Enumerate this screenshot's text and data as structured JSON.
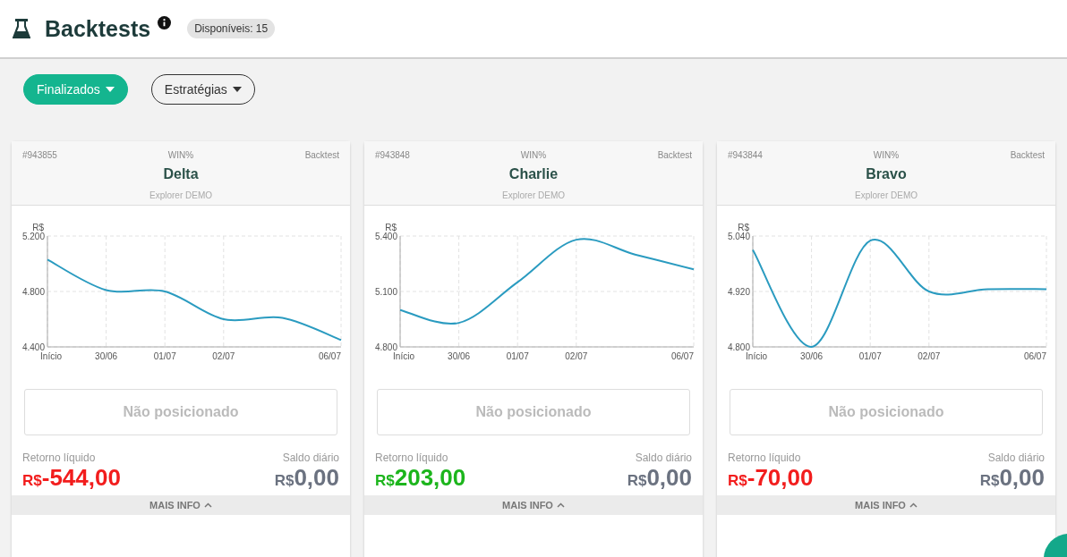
{
  "header": {
    "title": "Backtests",
    "badge": "Disponíveis: 15"
  },
  "filters": [
    {
      "label": "Finalizados",
      "selected": true
    },
    {
      "label": "Estratégias",
      "selected": false
    }
  ],
  "cards": [
    {
      "id": "#943855",
      "symbol": "WIN%",
      "type": "Backtest",
      "name": "Delta",
      "account": "Explorer DEMO",
      "chart_data": {
        "type": "line",
        "grid": true,
        "ylabel": "R$",
        "categories": [
          "Início",
          "30/06",
          "01/07",
          "02/07",
          null,
          "06/07"
        ],
        "series": [
          {
            "color": "#2a9bc0",
            "values": [
              5030,
              4810,
              4800,
              4600,
              4610,
              4450
            ]
          }
        ],
        "ylim": [
          4400,
          5200
        ],
        "yticks": [
          {
            "value": 4400,
            "label": "4.400"
          },
          {
            "value": 4800,
            "label": "4.800"
          },
          {
            "value": 5200,
            "label": "5.200"
          }
        ]
      },
      "status": "Não posicionado",
      "return_label": "Retorno líquido",
      "return_currency": "R$",
      "return_value": "-544,00",
      "color": "#f21d1d",
      "balance_label": "Saldo diário",
      "balance_currency": "R$",
      "balance_value": "0,00",
      "more": "MAIS INFO"
    },
    {
      "id": "#943848",
      "symbol": "WIN%",
      "type": "Backtest",
      "name": "Charlie",
      "account": "Explorer DEMO",
      "chart_data": {
        "type": "line",
        "grid": true,
        "ylabel": "R$",
        "categories": [
          "Início",
          "30/06",
          "01/07",
          "02/07",
          null,
          "06/07"
        ],
        "series": [
          {
            "color": "#2a9bc0",
            "values": [
              5000,
              4930,
              5150,
              5380,
              5300,
              5220
            ]
          }
        ],
        "ylim": [
          4800,
          5400
        ],
        "yticks": [
          {
            "value": 4800,
            "label": "4.800"
          },
          {
            "value": 5100,
            "label": "5.100"
          },
          {
            "value": 5400,
            "label": "5.400"
          }
        ]
      },
      "status": "Não posicionado",
      "return_label": "Retorno líquido",
      "return_currency": "R$",
      "return_value": "203,00",
      "color": "#1cb51c",
      "balance_label": "Saldo diário",
      "balance_currency": "R$",
      "balance_value": "0,00",
      "more": "MAIS INFO"
    },
    {
      "id": "#943844",
      "symbol": "WIN%",
      "type": "Backtest",
      "name": "Bravo",
      "account": "Explorer DEMO",
      "chart_data": {
        "type": "line",
        "grid": true,
        "ylabel": "R$",
        "categories": [
          "Início",
          "30/06",
          "01/07",
          "02/07",
          null,
          "06/07"
        ],
        "series": [
          {
            "color": "#2a9bc0",
            "values": [
              5010,
              4800,
              5030,
              4920,
              4925,
              4925
            ]
          }
        ],
        "ylim": [
          4800,
          5040
        ],
        "yticks": [
          {
            "value": 4800,
            "label": "4.800"
          },
          {
            "value": 4920,
            "label": "4.920"
          },
          {
            "value": 5040,
            "label": "5.040"
          }
        ]
      },
      "status": "Não posicionado",
      "return_label": "Retorno líquido",
      "return_currency": "R$",
      "return_value": "-70,00",
      "color": "#f21d1d",
      "balance_label": "Saldo diário",
      "balance_currency": "R$",
      "balance_value": "0,00",
      "more": "MAIS INFO"
    }
  ]
}
